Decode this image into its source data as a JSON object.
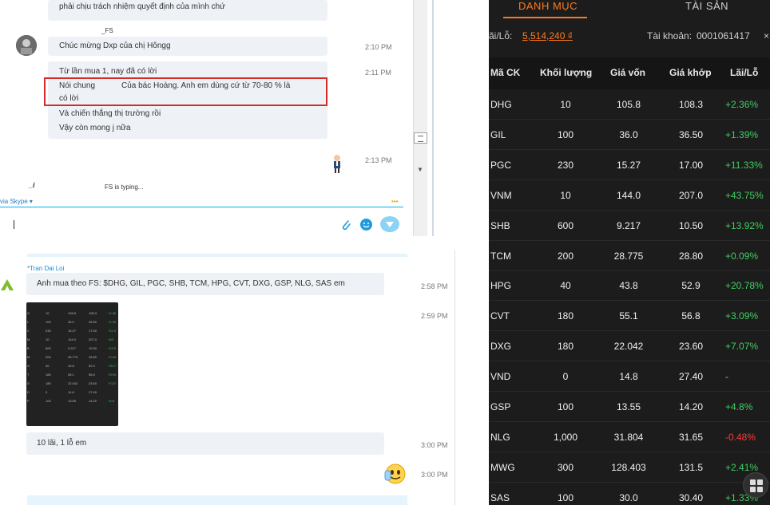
{
  "chat_top": {
    "truncated_line": "phải chịu trách nhiệm quyết định của mình chứ",
    "sender_fs": "_FS",
    "messages": [
      {
        "text": "Chúc mừng Dxp của chị Hôngg",
        "time": "2:10 PM"
      },
      {
        "text": "Từ lần mua 1, nay đã có lời",
        "time": "2:11 PM"
      },
      {
        "text": "Nói chung",
        "text2": "Của bác Hoàng. Anh em dùng cứ từ 70-80 % là",
        "text3": "có lời"
      },
      {
        "text": "Và chiến thắng thị trường rồi"
      },
      {
        "text": "Vậy còn mong j nữa"
      }
    ],
    "sticker_time": "2:13 PM",
    "typing_prefix": "_i",
    "typing_text": "FS is typing...",
    "via_label": "via Skype ▾",
    "ellipsis": "•••"
  },
  "chat_bottom": {
    "sender_name": "*Tran Dai Loi",
    "message1": "Anh mua theo FS: $DHG, GIL, PGC, SHB, TCM, HPG, CVT, DXG, GSP, NLG, SAS em",
    "time1": "2:58 PM",
    "time2": "2:59 PM",
    "message3": "10 lãi, 1 lỗ em",
    "time3": "3:00 PM",
    "time4": "3:00 PM"
  },
  "portfolio": {
    "tabs": [
      "DANH MỤC",
      "TÀI SẢN"
    ],
    "pl_label": "ãi/Lỗ:",
    "pl_value": "5,514,240 ₫",
    "account_label": "Tài khoản:",
    "account_value": "0001061417",
    "columns": [
      "Mã CK",
      "Khối lượng",
      "Giá vốn",
      "Giá khớp",
      "Lãi/Lỗ"
    ],
    "rows": [
      {
        "code": "DHG",
        "vol": "10",
        "cost": "105.8",
        "match": "108.3",
        "pl": "+2.36%",
        "sign": "pos"
      },
      {
        "code": "GIL",
        "vol": "100",
        "cost": "36.0",
        "match": "36.50",
        "pl": "+1.39%",
        "sign": "pos"
      },
      {
        "code": "PGC",
        "vol": "230",
        "cost": "15.27",
        "match": "17.00",
        "pl": "+11.33%",
        "sign": "pos"
      },
      {
        "code": "VNM",
        "vol": "10",
        "cost": "144.0",
        "match": "207.0",
        "pl": "+43.75%",
        "sign": "pos"
      },
      {
        "code": "SHB",
        "vol": "600",
        "cost": "9.217",
        "match": "10.50",
        "pl": "+13.92%",
        "sign": "pos"
      },
      {
        "code": "TCM",
        "vol": "200",
        "cost": "28.775",
        "match": "28.80",
        "pl": "+0.09%",
        "sign": "pos"
      },
      {
        "code": "HPG",
        "vol": "40",
        "cost": "43.8",
        "match": "52.9",
        "pl": "+20.78%",
        "sign": "pos"
      },
      {
        "code": "CVT",
        "vol": "180",
        "cost": "55.1",
        "match": "56.8",
        "pl": "+3.09%",
        "sign": "pos"
      },
      {
        "code": "DXG",
        "vol": "180",
        "cost": "22.042",
        "match": "23.60",
        "pl": "+7.07%",
        "sign": "pos"
      },
      {
        "code": "VND",
        "vol": "0",
        "cost": "14.8",
        "match": "27.40",
        "pl": "-",
        "sign": "zero"
      },
      {
        "code": "GSP",
        "vol": "100",
        "cost": "13.55",
        "match": "14.20",
        "pl": "+4.8%",
        "sign": "pos"
      },
      {
        "code": "NLG",
        "vol": "1,000",
        "cost": "31.804",
        "match": "31.65",
        "pl": "-0.48%",
        "sign": "neg"
      },
      {
        "code": "MWG",
        "vol": "300",
        "cost": "128.403",
        "match": "131.5",
        "pl": "+2.41%",
        "sign": "pos"
      },
      {
        "code": "SAS",
        "vol": "100",
        "cost": "30.0",
        "match": "30.40",
        "pl": "+1.33%",
        "sign": "pos"
      }
    ]
  },
  "colors": {
    "accent": "#ff7a1a",
    "positive": "#3fcf62",
    "negative": "#ff3b3b",
    "highlight_box": "#d42a2a",
    "skype_blue": "#00aff0"
  }
}
